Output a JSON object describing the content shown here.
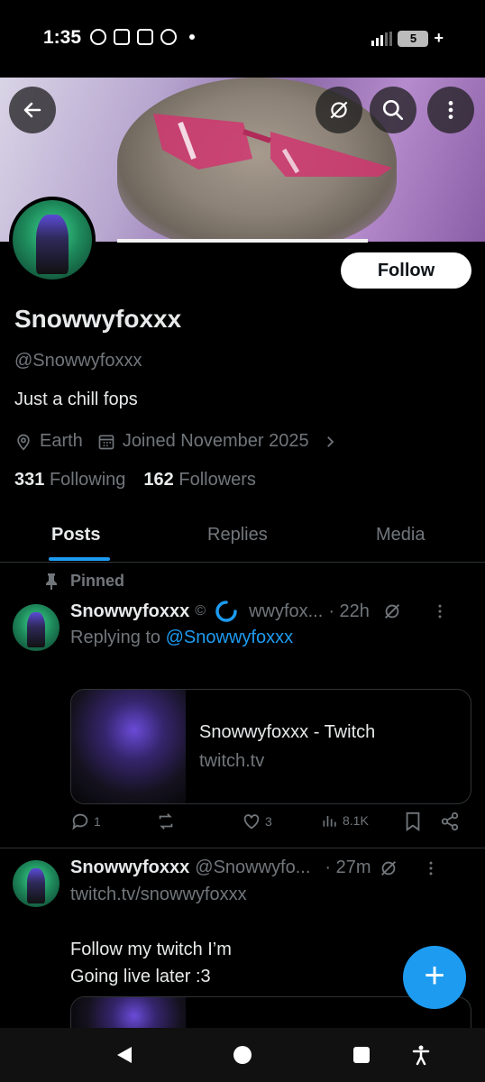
{
  "status_bar": {
    "time": "1:35",
    "battery": "5",
    "battery_suffix": "+"
  },
  "profile": {
    "display_name": "Snowwyfoxxx",
    "handle": "@Snowwyfoxxx",
    "bio": "Just a chill fops",
    "location": "Earth",
    "joined": "Joined November 2025",
    "following_count": "331",
    "following_label": "Following",
    "followers_count": "162",
    "followers_label": "Followers",
    "follow_button": "Follow"
  },
  "tabs": [
    {
      "label": "Posts",
      "active": true
    },
    {
      "label": "Replies",
      "active": false
    },
    {
      "label": "Media",
      "active": false
    }
  ],
  "posts": [
    {
      "pinned_label": "Pinned",
      "name": "Snowwyfoxxx",
      "handle": "wwyfox...",
      "time": "· 22h",
      "reply_prefix": "Replying to",
      "reply_handle": "@Snowwyfoxxx",
      "card_title": "Snowwyfoxxx - Twitch",
      "card_domain": "twitch.tv",
      "replies": "1",
      "reposts": "",
      "likes": "3",
      "views": "8.1K"
    },
    {
      "name": "Snowwyfoxxx",
      "handle": "@Snowwyfo...",
      "time": "· 27m",
      "link": "twitch.tv/snowwyfoxxx",
      "text_line1": "Follow my twitch I’m",
      "text_line2": "Going live later :3"
    }
  ],
  "fab_label": "+",
  "colors": {
    "accent": "#1d9bf0",
    "background": "#000000",
    "muted": "#71767b"
  }
}
